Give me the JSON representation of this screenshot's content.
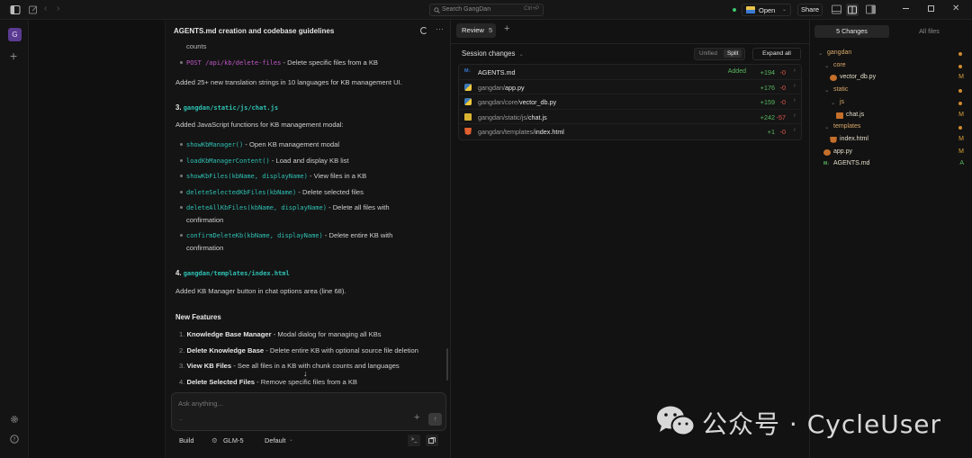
{
  "titlebar": {
    "search_placeholder": "Search GangDan",
    "search_shortcut": "Ctrl+P",
    "open_label": "Open",
    "share_label": "Share"
  },
  "workspace": {
    "avatar_letter": "G"
  },
  "conversation": {
    "title": "AGENTS.md creation and codebase guidelines",
    "intro_fragment": "counts",
    "api_item": {
      "code": "POST /api/kb/delete-files",
      "text": "- Delete specific files from a KB"
    },
    "translations_note": "Added 25+ new translation strings in 10 languages for KB management UI.",
    "section3": {
      "number": "3.",
      "path": "gangdan/static/js/chat.js",
      "description": "Added JavaScript functions for KB management modal:",
      "functions": [
        {
          "code": "showKbManager()",
          "text": "- Open KB management modal"
        },
        {
          "code": "loadKbManagerContent()",
          "text": "- Load and display KB list"
        },
        {
          "code": "showKbFiles(kbName, displayName)",
          "text": "- View files in a KB"
        },
        {
          "code": "deleteSelectedKbFiles(kbName)",
          "text": "- Delete selected files"
        },
        {
          "code": "deleteAllKbFiles(kbName, displayName)",
          "text": "- Delete all files with",
          "text2": "confirmation"
        },
        {
          "code": "confirmDeleteKb(kbName, displayName)",
          "text": "- Delete entire KB with",
          "text2": "confirmation"
        }
      ]
    },
    "section4": {
      "number": "4.",
      "path": "gangdan/templates/index.html",
      "description": "Added KB Manager button in chat options area (line 68)."
    },
    "features_heading": "New Features",
    "features": [
      {
        "n": "1.",
        "bold": "Knowledge Base Manager",
        "text": " - Modal dialog for managing all KBs"
      },
      {
        "n": "2.",
        "bold": "Delete Knowledge Base",
        "text": " - Delete entire KB with optional source file deletion"
      },
      {
        "n": "3.",
        "bold": "View KB Files",
        "text": " - See all files in a KB with chunk counts and languages"
      },
      {
        "n": "4.",
        "bold": "Delete Selected Files",
        "text": " - Remove specific files from a KB"
      }
    ],
    "composer": {
      "placeholder": "Ask anything...",
      "hint": "..",
      "mode": "Build",
      "model": "GLM-5",
      "variant": "Default"
    }
  },
  "review": {
    "tab_label": "Review",
    "tab_count": "5",
    "session_label": "Session changes",
    "unified_label": "Unified",
    "split_label": "Split",
    "expand_label": "Expand all",
    "files": [
      {
        "dir": "",
        "name": "AGENTS.md",
        "status": "Added",
        "added": "+194",
        "removed": "-0",
        "icon": "markdown-icon",
        "color": "#3b7bd6"
      },
      {
        "dir": "gangdan/",
        "name": "app.py",
        "status": "",
        "added": "+176",
        "removed": "-0",
        "icon": "python-icon",
        "color": "#3c78b5"
      },
      {
        "dir": "gangdan/core/",
        "name": "vector_db.py",
        "status": "",
        "added": "+159",
        "removed": "-0",
        "icon": "python-icon",
        "color": "#3c78b5"
      },
      {
        "dir": "gangdan/static/js/",
        "name": "chat.js",
        "status": "",
        "added": "+242",
        "removed": "-57",
        "icon": "javascript-icon",
        "color": "#d8b431"
      },
      {
        "dir": "gangdan/templates/",
        "name": "index.html",
        "status": "",
        "added": "+1",
        "removed": "-0",
        "icon": "html-icon",
        "color": "#e0612f"
      }
    ]
  },
  "file_tree": {
    "changes_tab": "5 Changes",
    "all_tab": "All files",
    "items": [
      {
        "name": "gangdan",
        "depth": 0,
        "type": "folder",
        "mark": "dot"
      },
      {
        "name": "core",
        "depth": 1,
        "type": "folder",
        "mark": "dot"
      },
      {
        "name": "vector_db.py",
        "depth": 2,
        "type": "file",
        "mark": "M",
        "icon": "python-icon",
        "color": "#c46f2a"
      },
      {
        "name": "static",
        "depth": 1,
        "type": "folder",
        "mark": "dot"
      },
      {
        "name": "js",
        "depth": 2,
        "type": "folder",
        "mark": "dot"
      },
      {
        "name": "chat.js",
        "depth": 3,
        "type": "file",
        "mark": "M",
        "icon": "javascript-icon",
        "color": "#c46f2a"
      },
      {
        "name": "templates",
        "depth": 1,
        "type": "folder",
        "mark": "dot"
      },
      {
        "name": "index.html",
        "depth": 2,
        "type": "file",
        "mark": "M",
        "icon": "html-icon",
        "color": "#c46f2a"
      },
      {
        "name": "app.py",
        "depth": 1,
        "type": "file",
        "mark": "M",
        "icon": "python-icon",
        "color": "#c46f2a"
      },
      {
        "name": "AGENTS.md",
        "depth": 1,
        "type": "file",
        "mark": "A",
        "icon": "markdown-icon",
        "color": "#59b860"
      }
    ],
    "colors": {
      "modified": "#d9a23a",
      "added": "#59b860",
      "folder_dot": "#d08b30"
    }
  },
  "watermark": {
    "text": "公众号 · CycleUser"
  }
}
